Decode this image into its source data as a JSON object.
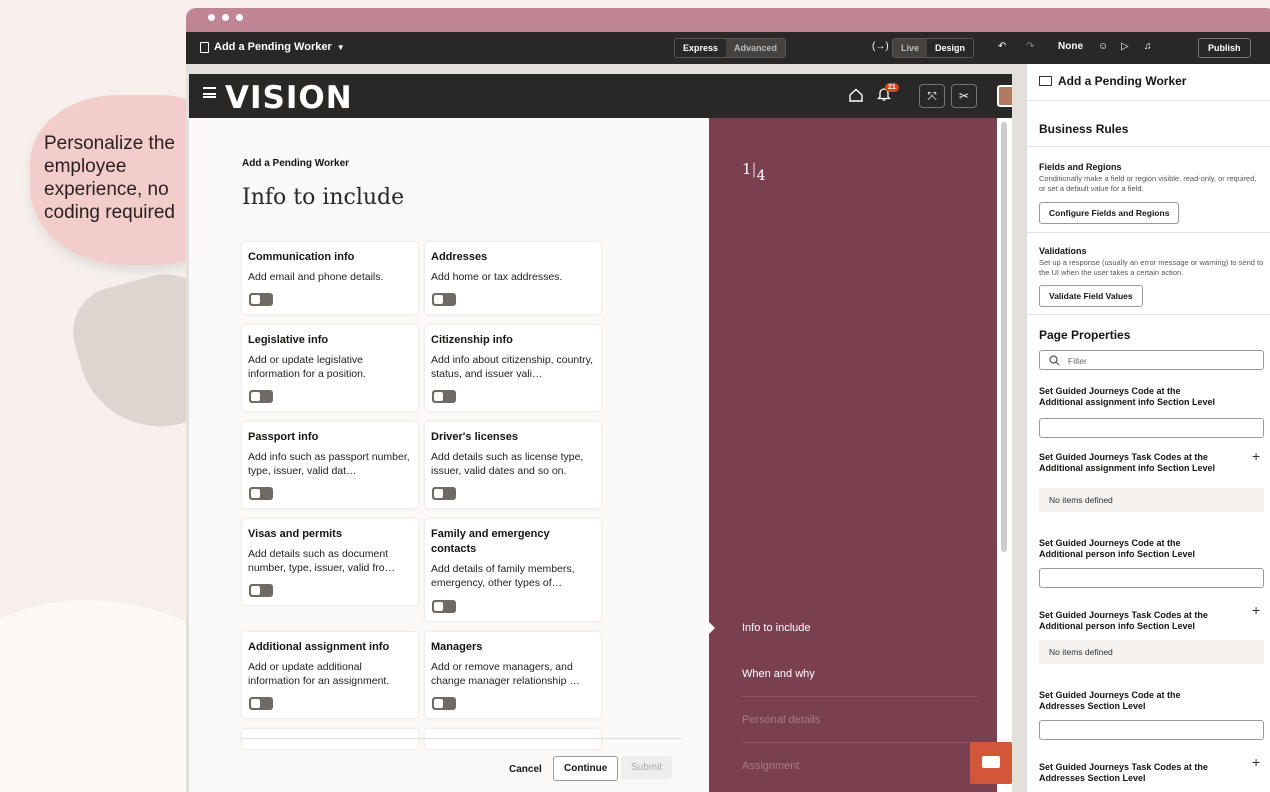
{
  "callout": "Personalize the employee experience, no coding required",
  "editor": {
    "doc_title": "Add a Pending Worker",
    "mode_express": "Express",
    "mode_advanced": "Advanced",
    "var_icon": "(→)",
    "live": "Live",
    "design": "Design",
    "undo": "↶",
    "redo": "↷",
    "none": "None",
    "publish": "Publish"
  },
  "vision": {
    "logo": "VISION",
    "notification_count": "21"
  },
  "page": {
    "breadcrumb": "Add a Pending Worker",
    "title": "Info to include",
    "cards": [
      {
        "title": "Communication info",
        "desc": "Add email and phone details."
      },
      {
        "title": "Addresses",
        "desc": "Add home or tax addresses."
      },
      {
        "title": "Legislative info",
        "desc": "Add or update legislative information for a position."
      },
      {
        "title": "Citizenship info",
        "desc": "Add info about citizenship, country, status, and issuer vali…"
      },
      {
        "title": "Passport info",
        "desc": "Add info such as passport number, type, issuer, valid dat…"
      },
      {
        "title": "Driver's licenses",
        "desc": "Add details such as license type, issuer, valid dates and so on."
      },
      {
        "title": "Visas and permits",
        "desc": "Add details such as document number, type, issuer, valid fro…"
      },
      {
        "title": "Family and emergency contacts",
        "desc": "Add details of family members, emergency, other types of…"
      },
      {
        "title": "Additional assignment info",
        "desc": "Add or update additional information for an assignment."
      },
      {
        "title": "Managers",
        "desc": "Add or remove managers, and change manager relationship …"
      }
    ],
    "cancel": "Cancel",
    "continue": "Continue",
    "submit": "Submit"
  },
  "steps": {
    "current": "1",
    "total": "4",
    "items": [
      "Info to include",
      "When and why",
      "Personal details",
      "Assignment"
    ]
  },
  "panel": {
    "title": "Add a Pending Worker",
    "business_rules": "Business Rules",
    "fields_title": "Fields and Regions",
    "fields_desc": "Conditionally make a field or region visible, read-only, or required, or set a default value for a field.",
    "fields_btn": "Configure Fields and Regions",
    "validations_title": "Validations",
    "validations_desc": "Set up a response (usually an error message or warning) to send to the UI when the user takes a certain action.",
    "validations_btn": "Validate Field Values",
    "page_properties": "Page Properties",
    "filter_placeholder": "Filter",
    "prop1": "Set Guided Journeys Code at the Additional assignment info Section Level",
    "prop2": "Set Guided Journeys Task Codes at the Additional assignment info Section Level",
    "no_items_1": "No items defined",
    "prop3": "Set Guided Journeys Code at the Additional person info Section Level",
    "prop4": "Set Guided Journeys Task Codes at the Additional person info Section Level",
    "no_items_2": "No items defined",
    "prop5": "Set Guided Journeys Code at the Addresses Section Level",
    "prop6": "Set Guided Journeys Task Codes at the Addresses Section Level"
  }
}
